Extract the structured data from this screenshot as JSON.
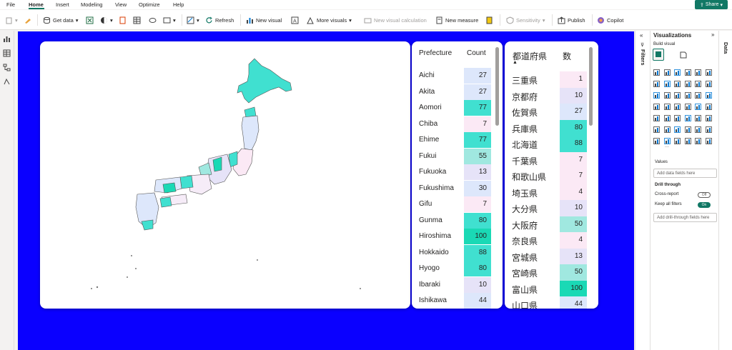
{
  "menu": {
    "items": [
      "File",
      "Home",
      "Insert",
      "Modeling",
      "View",
      "Optimize",
      "Help"
    ],
    "share": "Share"
  },
  "ribbon": {
    "get_data": "Get data",
    "refresh": "Refresh",
    "new_visual": "New visual",
    "more_visuals": "More visuals",
    "new_visual_calculation": "New visual calculation",
    "new_measure": "New measure",
    "sensitivity": "Sensitivity",
    "publish": "Publish",
    "copilot": "Copilot"
  },
  "colors": {
    "canvas": "#0a00ff",
    "accent": "#117865",
    "teal_high": "#1ad9b5",
    "teal_mid": "#40e0d0",
    "blue_light": "#dde7fb",
    "pink_light": "#fbe9f5"
  },
  "table1": {
    "headers": {
      "key": "Prefecture",
      "value": "Count"
    },
    "rows": [
      {
        "k": "Aichi",
        "v": "27"
      },
      {
        "k": "Akita",
        "v": "27"
      },
      {
        "k": "Aomori",
        "v": "77"
      },
      {
        "k": "Chiba",
        "v": "7"
      },
      {
        "k": "Ehime",
        "v": "77"
      },
      {
        "k": "Fukui",
        "v": "55"
      },
      {
        "k": "Fukuoka",
        "v": "13"
      },
      {
        "k": "Fukushima",
        "v": "30"
      },
      {
        "k": "Gifu",
        "v": "7"
      },
      {
        "k": "Gunma",
        "v": "80"
      },
      {
        "k": "Hiroshima",
        "v": "100"
      },
      {
        "k": "Hokkaido",
        "v": "88"
      },
      {
        "k": "Hyogo",
        "v": "80"
      },
      {
        "k": "Ibaraki",
        "v": "10"
      },
      {
        "k": "Ishikawa",
        "v": "44"
      }
    ]
  },
  "table2": {
    "headers": {
      "key": "都道府県",
      "value": "数"
    },
    "rows": [
      {
        "k": "三重県",
        "v": "1"
      },
      {
        "k": "京都府",
        "v": "10"
      },
      {
        "k": "佐賀県",
        "v": "27"
      },
      {
        "k": "兵庫県",
        "v": "80"
      },
      {
        "k": "北海道",
        "v": "88"
      },
      {
        "k": "千葉県",
        "v": "7"
      },
      {
        "k": "和歌山県",
        "v": "7"
      },
      {
        "k": "埼玉県",
        "v": "4"
      },
      {
        "k": "大分県",
        "v": "10"
      },
      {
        "k": "大阪府",
        "v": "50"
      },
      {
        "k": "奈良県",
        "v": "4"
      },
      {
        "k": "宮城県",
        "v": "13"
      },
      {
        "k": "宮崎県",
        "v": "50"
      },
      {
        "k": "富山県",
        "v": "100"
      },
      {
        "k": "山口県",
        "v": "44"
      }
    ]
  },
  "panes": {
    "filters": "Filters",
    "visualizations": "Visualizations",
    "data": "Data",
    "build_visual": "Build visual",
    "values": "Values",
    "add_data_fields": "Add data fields here",
    "drill_through": "Drill through",
    "cross_report": "Cross-report",
    "cross_report_state": "Off",
    "keep_all_filters": "Keep all filters",
    "keep_all_filters_state": "On",
    "add_drill_fields": "Add drill-through fields here"
  }
}
